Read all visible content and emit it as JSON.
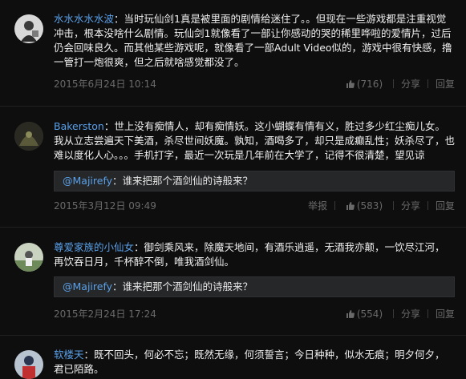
{
  "comments": [
    {
      "username": "水水水水水波",
      "text": "当时玩仙剑1真是被里面的剧情给迷住了。。但现在一些游戏都是注重视觉冲击，根本没啥什么剧情。玩仙剑1就像看了一部让你感动的哭的稀里哗啦的爱情片，过后仍会回味良久。而其他某些游戏呢，就像看了一部Adult Video似的，游戏中很有快感，撸一管打一炮很爽，但之后就啥感觉都没了。",
      "date": "2015年6月24日 10:14",
      "likes": "(716)",
      "share": "分享",
      "reply": "回复"
    },
    {
      "username": "Bakerston",
      "text": "世上没有痴情人，却有痴情妖。这小蝴蝶有情有义，胜过多少红尘痴儿女。我从立志尝遍天下美酒，杀尽世间妖魔。孰知，酒喝多了，却只是成癫乱性；妖杀尽了，也难以度化人心。。。手机打字，最近一次玩是几年前在大学了，记得不很清楚，望见谅",
      "quote_user": "@Majirefy",
      "quote_text": "谁来把那个酒剑仙的诗般来？",
      "date": "2015年3月12日 09:49",
      "report": "举报",
      "likes": "(583)",
      "share": "分享",
      "reply": "回复"
    },
    {
      "username": "尊爱家族的小仙女",
      "text": "御剑乘风来，除魔天地间，有酒乐逍遥，无酒我亦颠，一饮尽江河，再饮吞日月，千杯醉不倒，唯我酒剑仙。",
      "quote_user": "@Majirefy",
      "quote_text": "谁来把那个酒剑仙的诗般来？",
      "date": "2015年2月24日 17:24",
      "likes": "(554)",
      "share": "分享",
      "reply": "回复"
    },
    {
      "username": "软楼天",
      "text": "既不回头，何必不忘；既然无缘，何须誓言；今日种种，似水无痕；明夕何夕，君已陌路。"
    }
  ],
  "colors": {
    "username": "#5aa0e8",
    "background": "#0e0e0f",
    "meta": "#6a6a6a"
  }
}
